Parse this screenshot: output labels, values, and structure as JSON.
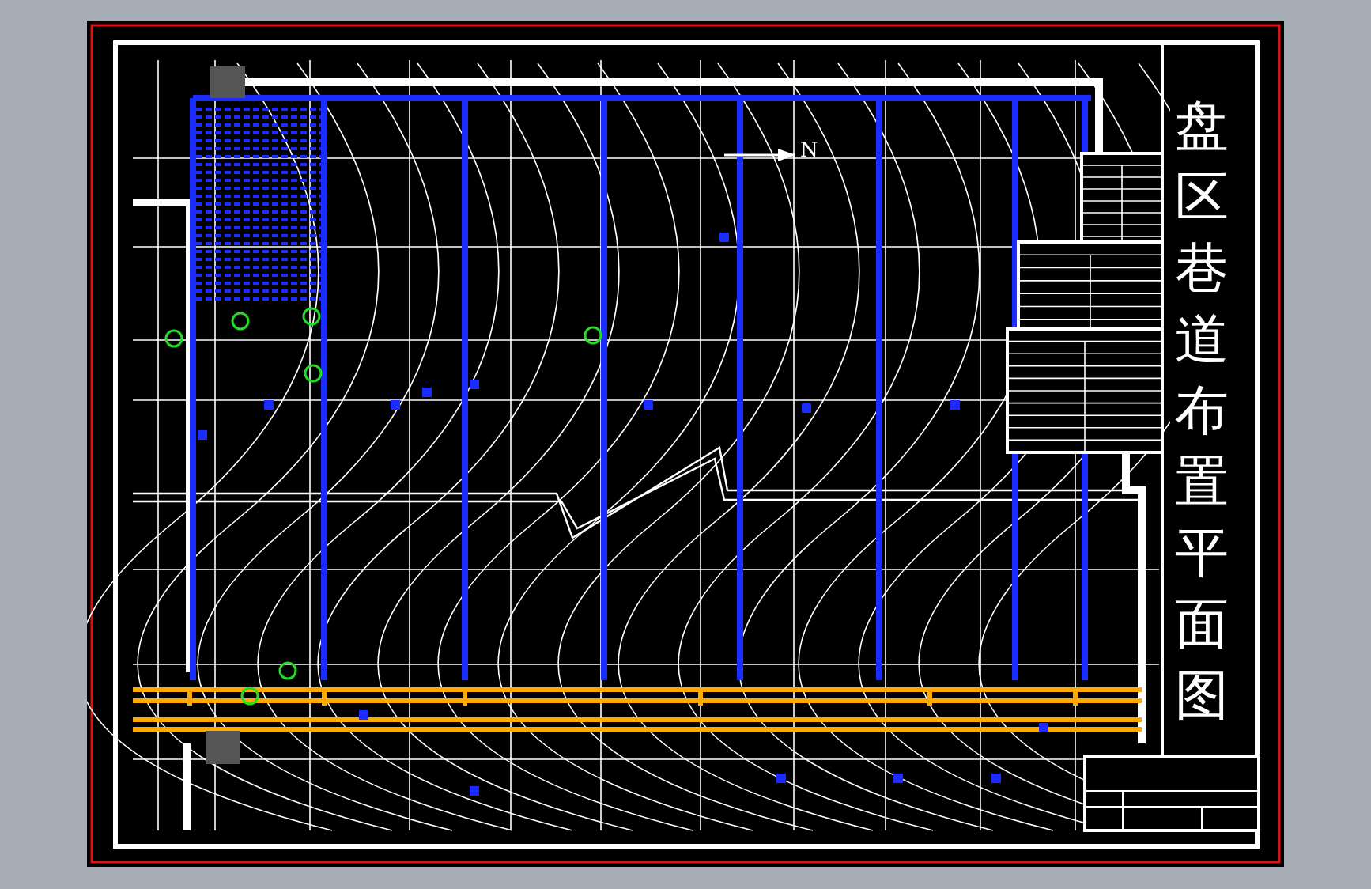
{
  "drawing": {
    "title": "盘区巷道布置平面图",
    "north_label": "N"
  }
}
